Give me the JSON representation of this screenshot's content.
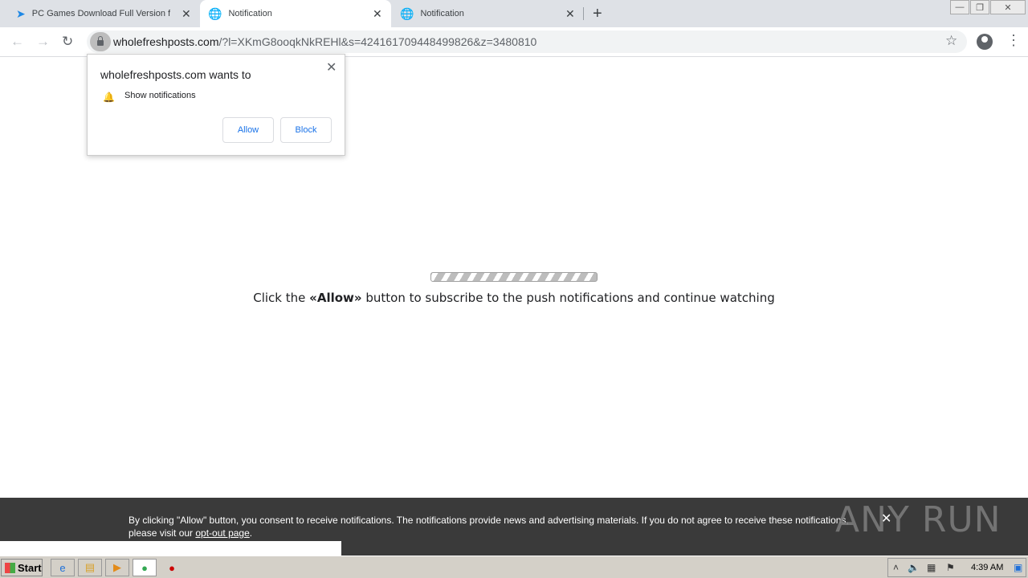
{
  "tabs": [
    {
      "title": "PC Games Download Full Version for",
      "icon": "feather-icon"
    },
    {
      "title": "Notification",
      "icon": "globe-icon"
    },
    {
      "title": "Notification",
      "icon": "globe-icon"
    }
  ],
  "toolbar": {
    "url_host": "wholefreshposts.com",
    "url_rest": "/?l=XKmG8ooqkNkREHl&s=424161709448499826&z=3480810"
  },
  "popup": {
    "title": "wholefreshposts.com wants to",
    "permission": "Show notifications",
    "allow_label": "Allow",
    "block_label": "Block"
  },
  "page": {
    "message_before": "Click the ",
    "message_bold": "«Allow»",
    "message_after": " button to subscribe to the push notifications and continue watching"
  },
  "banner": {
    "text": "By clicking \"Allow\" button, you consent to receive notifications. The notifications provide news and advertising materials. If you do not agree to receive these notifications, please visit our ",
    "link": "opt-out page",
    "text_end": ".",
    "watermark": "ANY RUN"
  },
  "taskbar": {
    "start_label": "Start",
    "clock": "4:39 AM"
  }
}
